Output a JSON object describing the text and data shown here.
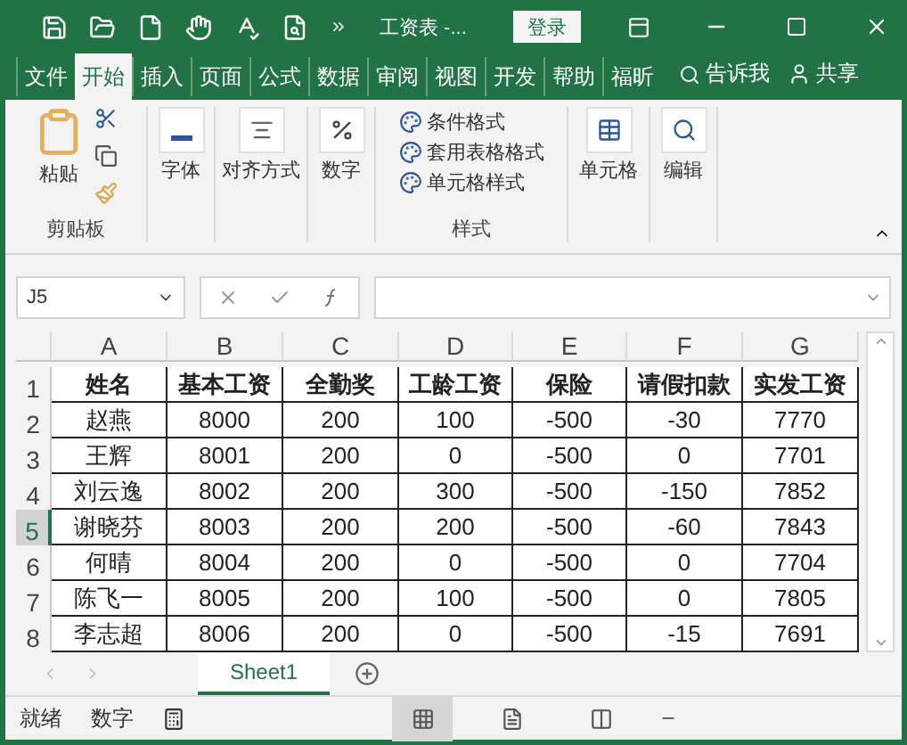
{
  "title_bar": {
    "title": "工资表 -...",
    "login": "登录"
  },
  "ribbon_tabs": [
    {
      "label": "文件",
      "selected": false
    },
    {
      "label": "开始",
      "selected": true
    },
    {
      "label": "插入",
      "selected": false
    },
    {
      "label": "页面",
      "selected": false
    },
    {
      "label": "公式",
      "selected": false
    },
    {
      "label": "数据",
      "selected": false
    },
    {
      "label": "审阅",
      "selected": false
    },
    {
      "label": "视图",
      "selected": false
    },
    {
      "label": "开发",
      "selected": false
    },
    {
      "label": "帮助",
      "selected": false
    },
    {
      "label": "福昕",
      "selected": false
    }
  ],
  "tell_me": "告诉我",
  "share": "共享",
  "clipboard": {
    "paste": "粘贴",
    "label": "剪贴板"
  },
  "big_buttons": [
    {
      "kind": "font",
      "label": "字体"
    },
    {
      "kind": "align",
      "label": "对齐方式"
    },
    {
      "kind": "number",
      "label": "数字"
    }
  ],
  "styles": {
    "items": [
      "条件格式",
      "套用表格格式",
      "单元格样式"
    ],
    "label": "样式"
  },
  "tail_buttons": [
    {
      "kind": "cells",
      "label": "单元格"
    },
    {
      "kind": "edit",
      "label": "编辑"
    }
  ],
  "formula_bar": {
    "name_box": "J5"
  },
  "columns": [
    "A",
    "B",
    "C",
    "D",
    "E",
    "F",
    "G"
  ],
  "rows": [
    {
      "number": "1",
      "selected": false,
      "header": true,
      "cells": [
        "姓名",
        "基本工资",
        "全勤奖",
        "工龄工资",
        "保险",
        "请假扣款",
        "实发工资"
      ]
    },
    {
      "number": "2",
      "selected": false,
      "header": false,
      "cells": [
        "赵燕",
        "8000",
        "200",
        "100",
        "-500",
        "-30",
        "7770"
      ]
    },
    {
      "number": "3",
      "selected": false,
      "header": false,
      "cells": [
        "王辉",
        "8001",
        "200",
        "0",
        "-500",
        "0",
        "7701"
      ]
    },
    {
      "number": "4",
      "selected": false,
      "header": false,
      "cells": [
        "刘云逸",
        "8002",
        "200",
        "300",
        "-500",
        "-150",
        "7852"
      ]
    },
    {
      "number": "5",
      "selected": true,
      "header": false,
      "cells": [
        "谢晓芬",
        "8003",
        "200",
        "200",
        "-500",
        "-60",
        "7843"
      ]
    },
    {
      "number": "6",
      "selected": false,
      "header": false,
      "cells": [
        "何晴",
        "8004",
        "200",
        "0",
        "-500",
        "0",
        "7704"
      ]
    },
    {
      "number": "7",
      "selected": false,
      "header": false,
      "cells": [
        "陈飞一",
        "8005",
        "200",
        "100",
        "-500",
        "0",
        "7805"
      ]
    },
    {
      "number": "8",
      "selected": false,
      "header": false,
      "cells": [
        "李志超",
        "8006",
        "200",
        "0",
        "-500",
        "-15",
        "7691"
      ]
    }
  ],
  "sheet_tabs": [
    {
      "label": "Sheet1",
      "selected": true
    }
  ],
  "status": [
    "就绪",
    "数字"
  ]
}
